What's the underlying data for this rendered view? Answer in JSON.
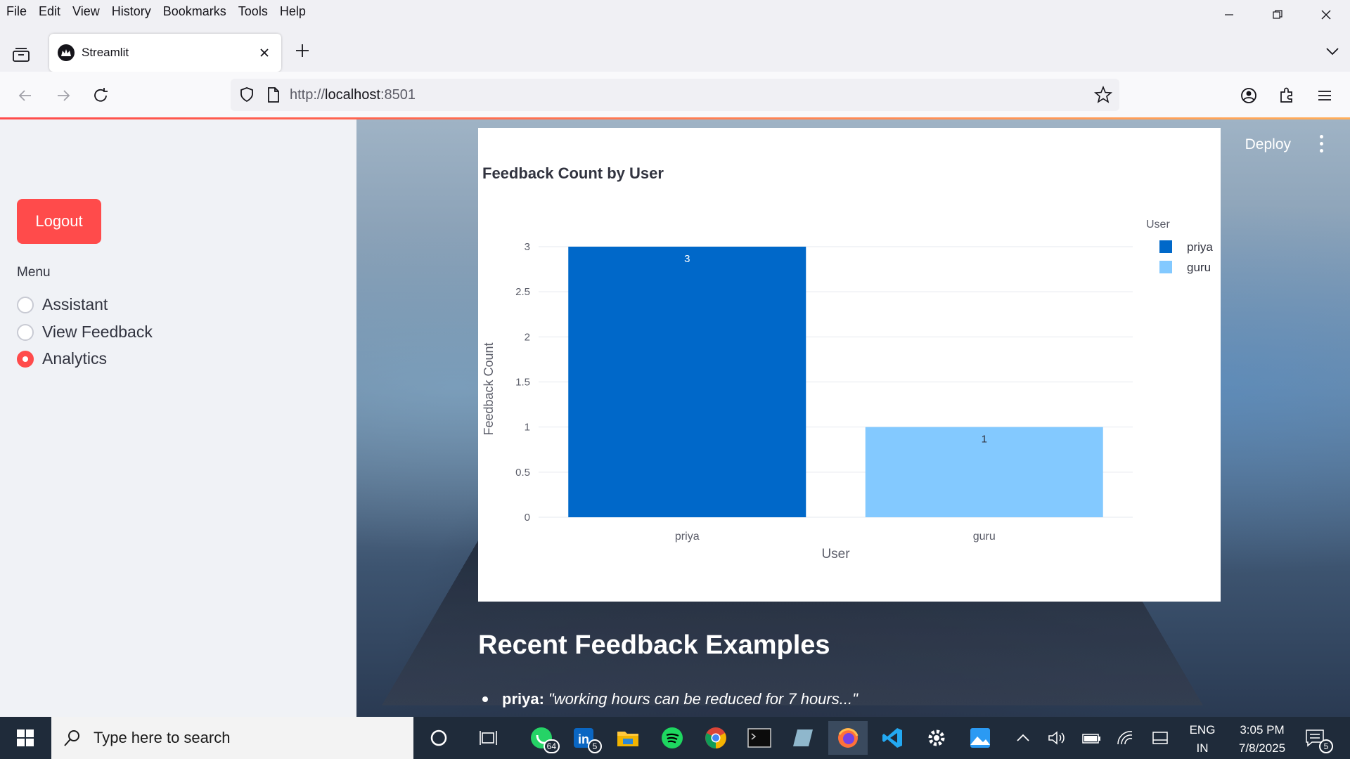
{
  "browser": {
    "menu": [
      "File",
      "Edit",
      "View",
      "History",
      "Bookmarks",
      "Tools",
      "Help"
    ],
    "tab_title": "Streamlit",
    "url_prefix": "http://",
    "url_host": "localhost",
    "url_port": ":8501"
  },
  "sidebar": {
    "logout_label": "Logout",
    "menu_label": "Menu",
    "options": [
      {
        "label": "Assistant",
        "selected": false
      },
      {
        "label": "View Feedback",
        "selected": false
      },
      {
        "label": "Analytics",
        "selected": true
      }
    ]
  },
  "header": {
    "deploy_label": "Deploy"
  },
  "chart_data": {
    "type": "bar",
    "title": "Feedback Count by User",
    "categories": [
      "priya",
      "guru"
    ],
    "values": [
      3,
      1
    ],
    "colors": [
      "#0068c9",
      "#83c9ff"
    ],
    "xlabel": "User",
    "ylabel": "Feedback Count",
    "ylim": [
      0,
      3
    ],
    "yticks": [
      "0",
      "0.5",
      "1",
      "1.5",
      "2",
      "2.5",
      "3"
    ],
    "legend_title": "User",
    "legend_position": "top-right",
    "grid": true
  },
  "main": {
    "section_title": "Recent Feedback Examples",
    "feedback": [
      {
        "user": "priya:",
        "text": "\"working hours can be reduced for 7 hours...\""
      }
    ]
  },
  "taskbar": {
    "search_placeholder": "Type here to search",
    "whatsapp_badge": "64",
    "linkedin_badge": "5",
    "notifications_badge": "5",
    "lang_line1": "ENG",
    "lang_line2": "IN",
    "time": "3:05 PM",
    "date": "7/8/2025"
  }
}
